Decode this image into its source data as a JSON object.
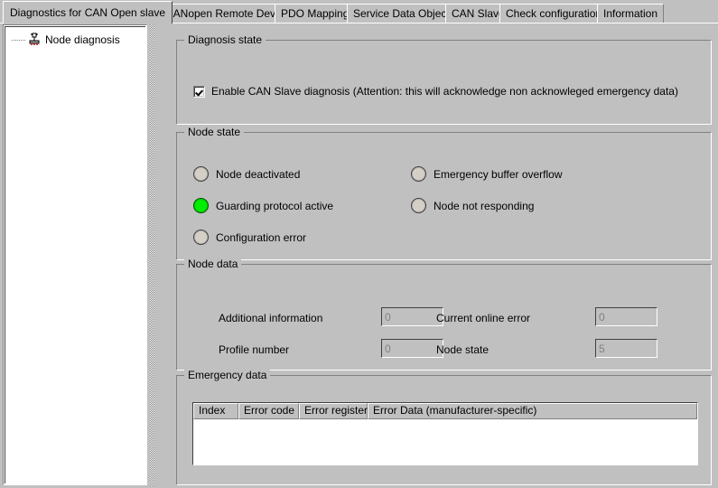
{
  "tabs": [
    {
      "label": "Diagnostics for CAN Open slave",
      "active": true
    },
    {
      "label": "CANopen Remote Device",
      "active": false
    },
    {
      "label": "PDO Mapping",
      "active": false
    },
    {
      "label": "Service Data Object",
      "active": false
    },
    {
      "label": "CAN Slave",
      "active": false
    },
    {
      "label": "Check configuration",
      "active": false
    },
    {
      "label": "Information",
      "active": false
    }
  ],
  "tree": {
    "items": [
      {
        "label": "Node diagnosis",
        "icon": "node-device-icon"
      }
    ]
  },
  "diagnosis_state": {
    "title": "Diagnosis state",
    "checkbox": {
      "label": "Enable CAN Slave diagnosis (Attention: this will acknowledge non acknowleged emergency data)",
      "checked": true
    }
  },
  "node_state": {
    "title": "Node state",
    "indicators": [
      {
        "label": "Node deactivated",
        "on": false
      },
      {
        "label": "Guarding protocol active",
        "on": true
      },
      {
        "label": "Configuration error",
        "on": false
      },
      {
        "label": "Emergency buffer overflow",
        "on": false
      },
      {
        "label": "Node not responding",
        "on": false
      }
    ]
  },
  "node_data": {
    "title": "Node data",
    "fields": [
      {
        "label": "Additional information",
        "value": "0"
      },
      {
        "label": "Profile number",
        "value": "0"
      },
      {
        "label": "Current online error",
        "value": "0"
      },
      {
        "label": "Node state",
        "value": "5"
      }
    ]
  },
  "emergency_data": {
    "title": "Emergency data",
    "columns": [
      "Index",
      "Error code",
      "Error register",
      "Error Data (manufacturer-specific)"
    ],
    "rows": []
  },
  "colors": {
    "face": "#c0c0c0",
    "led_on": "#00ee00",
    "led_off": "#d4d0c8",
    "disabled_text": "#808080"
  }
}
